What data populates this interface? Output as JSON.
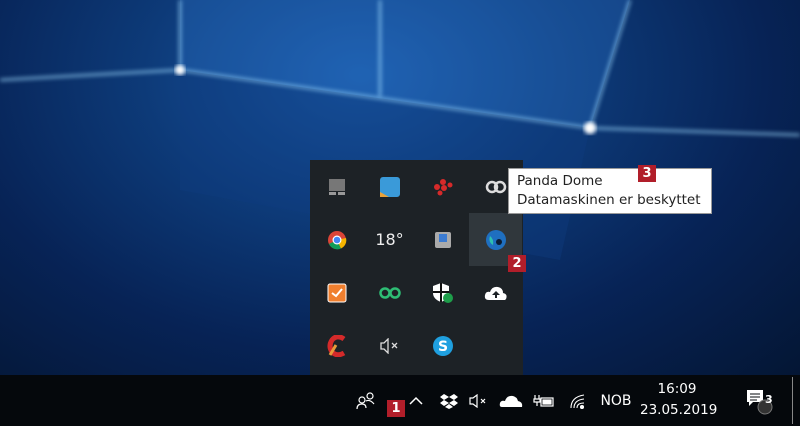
{
  "tooltip": {
    "title": "Panda Dome",
    "status": "Datamaskinen er beskyttet"
  },
  "badges": {
    "taskbar_chevron": "1",
    "panda_icon": "2",
    "tooltip": "3"
  },
  "flyout": {
    "icons": [
      "display-icon",
      "app-blue-icon",
      "cluster-icon",
      "creative-cloud-icon",
      "chrome-icon",
      "weather-icon",
      "drive-icon",
      "panda-dome-icon",
      "task-check-icon",
      "link-icon",
      "defender-shield-icon",
      "cloud-upload-icon",
      "ccleaner-icon",
      "volume-mute-icon",
      "skype-icon"
    ],
    "weather_temp": "18°"
  },
  "taskbar": {
    "language": "NOB",
    "time": "16:09",
    "date": "23.05.2019",
    "notification_count": "3"
  },
  "colors": {
    "badge": "#b11e2a",
    "taskbar": "#05080c",
    "flyout": "#1d2226"
  }
}
